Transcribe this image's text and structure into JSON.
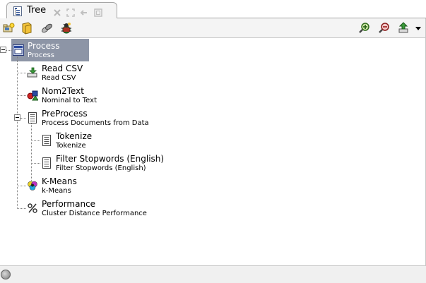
{
  "tab": {
    "label": "Tree",
    "icons": [
      "tree-view-icon",
      "close-icon",
      "maximize-icon",
      "minimize-icon",
      "restore-icon"
    ]
  },
  "toolbar": {
    "left_icons": [
      "new-process-icon",
      "open-icon",
      "link-icon",
      "bug-icon"
    ],
    "right_icons": [
      "zoom-in-icon",
      "zoom-out-icon",
      "export-icon",
      "dropdown-arrow-icon"
    ]
  },
  "tree": {
    "nodes": [
      {
        "title": "Process",
        "subtitle": "Process",
        "icon": "process-icon",
        "selected": true
      },
      {
        "title": "Read CSV",
        "subtitle": "Read CSV",
        "icon": "read-csv-icon"
      },
      {
        "title": "Nom2Text",
        "subtitle": "Nominal to Text",
        "icon": "nominal-to-text-icon"
      },
      {
        "title": "PreProcess",
        "subtitle": "Process Documents from Data",
        "icon": "document-icon"
      },
      {
        "title": "Tokenize",
        "subtitle": "Tokenize",
        "icon": "document-icon"
      },
      {
        "title": "Filter Stopwords (English)",
        "subtitle": "Filter Stopwords (English)",
        "icon": "document-icon"
      },
      {
        "title": "K-Means",
        "subtitle": "k-Means",
        "icon": "kmeans-icon"
      },
      {
        "title": "Performance",
        "subtitle": "Cluster Distance Performance",
        "icon": "percent-icon"
      }
    ]
  },
  "colors": {
    "selection": "#8d95a6",
    "toolbar_bg": "#f4f4f4"
  }
}
